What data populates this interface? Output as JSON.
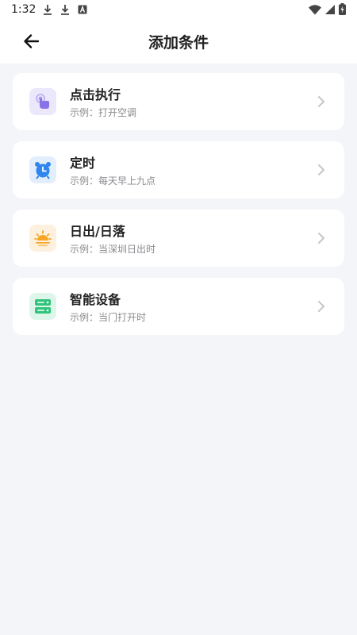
{
  "status": {
    "time": "1:32"
  },
  "header": {
    "title": "添加条件"
  },
  "items": [
    {
      "title": "点击执行",
      "subtitle": "示例：打开空调",
      "icon": "tap-hand-icon",
      "bg": "#ece8fb",
      "color": "#8a73e6"
    },
    {
      "title": "定时",
      "subtitle": "示例：每天早上九点",
      "icon": "alarm-clock-icon",
      "bg": "#e3eefc",
      "color": "#2f86ee"
    },
    {
      "title": "日出/日落",
      "subtitle": "示例：当深圳日出时",
      "icon": "sunrise-icon",
      "bg": "#fdf0de",
      "color": "#f6a623"
    },
    {
      "title": "智能设备",
      "subtitle": "示例：当门打开时",
      "icon": "server-device-icon",
      "bg": "#def6ea",
      "color": "#2fc37b"
    }
  ]
}
